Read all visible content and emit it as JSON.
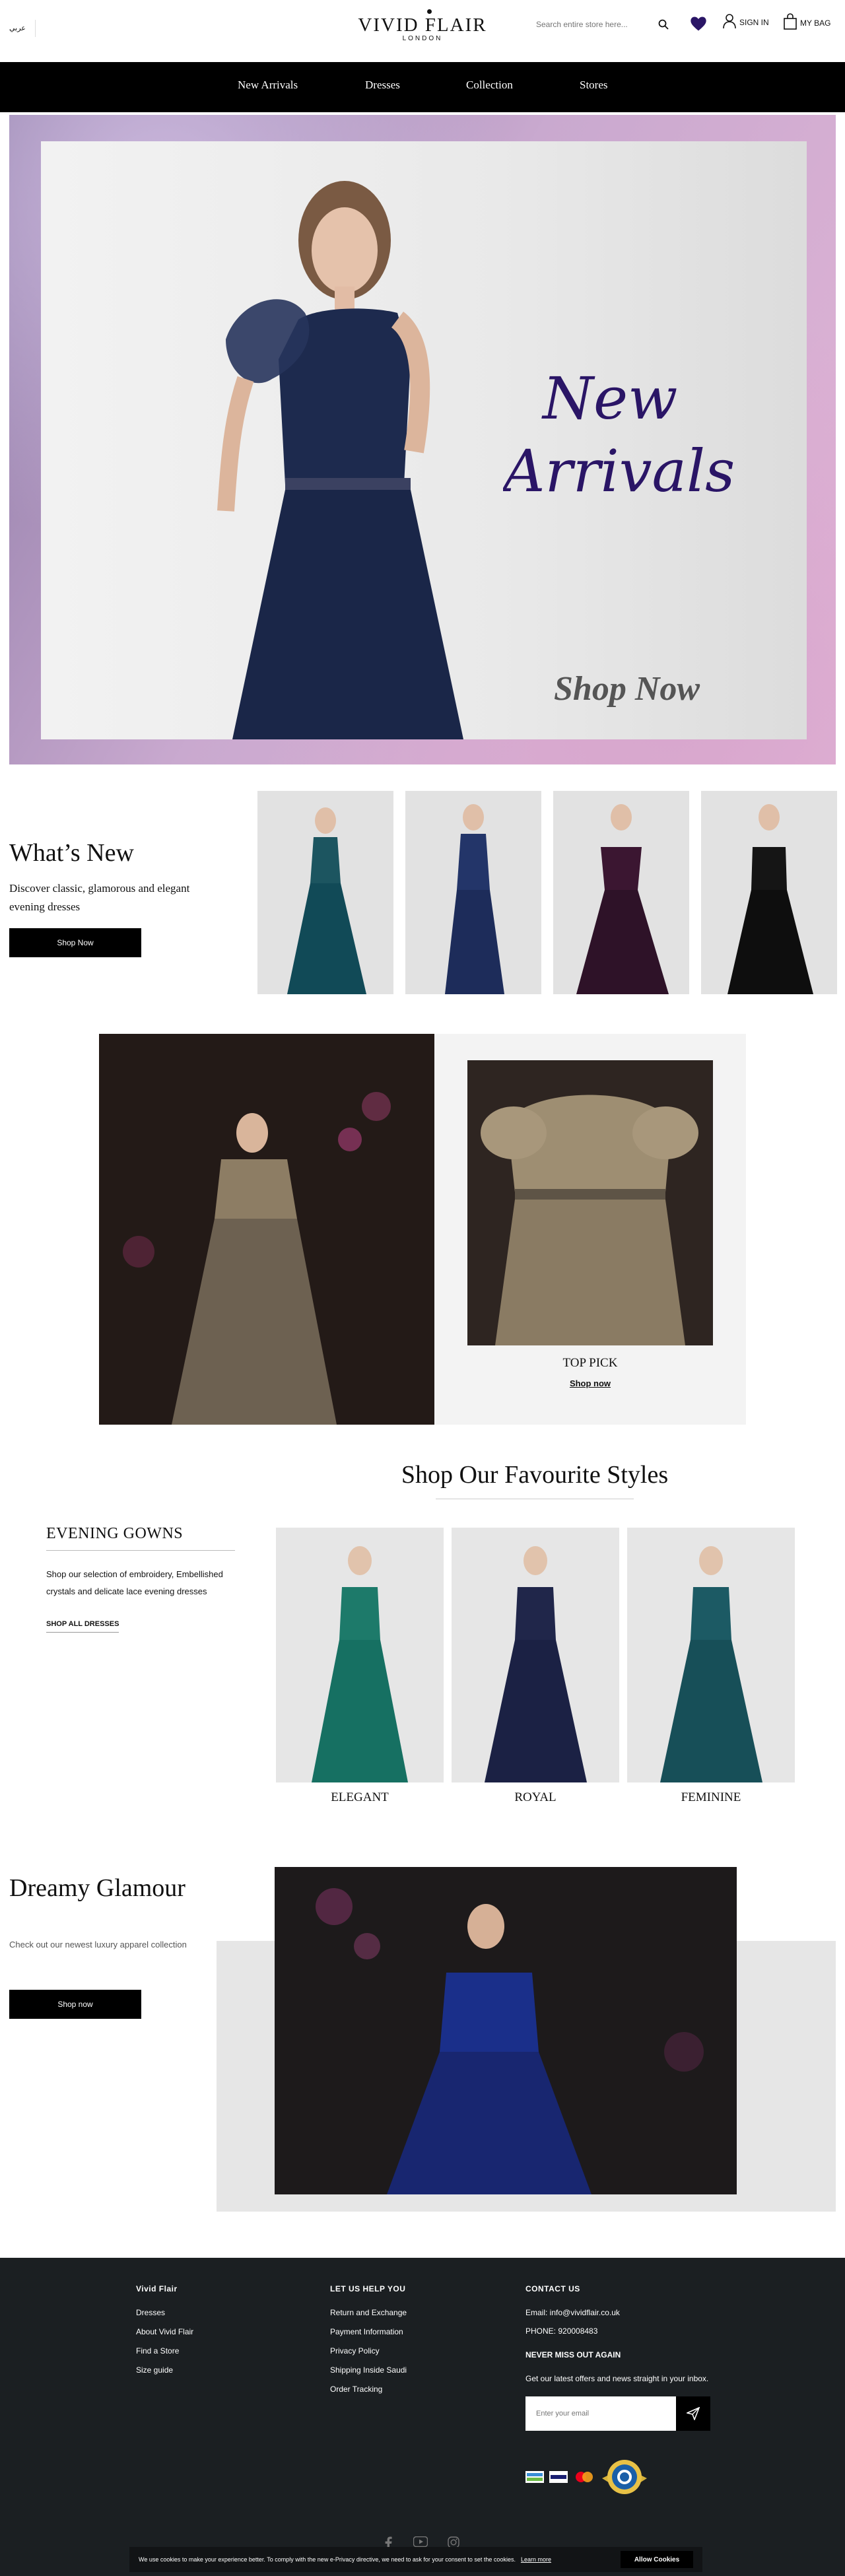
{
  "header": {
    "lang_label": "عربي",
    "logo_name": "VIVID FLAIR",
    "logo_sub": "LONDON",
    "search_placeholder": "Search entire store here...",
    "sign_in": "SIGN IN",
    "my_bag": "MY BAG"
  },
  "nav": [
    "New Arrivals",
    "Dresses",
    "Collection",
    "Stores"
  ],
  "hero": {
    "title_line1": "New",
    "title_line2": "Arrivals",
    "cta": "Shop Now"
  },
  "whats_new": {
    "title": "What’s New",
    "description": "Discover classic, glamorous and elegant evening dresses",
    "button": "Shop Now"
  },
  "top_pick": {
    "label": "TOP PICK",
    "link": "Shop now"
  },
  "favourites": {
    "title": "Shop Our Favourite Styles",
    "section_title": "EVENING GOWNS",
    "section_desc": "Shop our selection of embroidery, Embellished crystals and delicate lace evening dresses",
    "section_link": "SHOP ALL DRESSES",
    "styles": [
      "ELEGANT",
      "ROYAL",
      "FEMININE"
    ]
  },
  "dreamy": {
    "title": "Dreamy Glamour",
    "description": "Check out our newest luxury apparel collection",
    "button": "Shop now"
  },
  "footer": {
    "col1_head": "Vivid Flair",
    "col1_links": [
      "Dresses",
      "About Vivid Flair",
      "Find a Store",
      "Size guide"
    ],
    "col2_head": "LET US HELP YOU",
    "col2_links": [
      "Return and Exchange",
      "Payment Information",
      "Privacy Policy",
      "Shipping Inside Saudi",
      "Order Tracking"
    ],
    "col3_head": "CONTACT US",
    "email": "Email: info@vividflair.co.uk",
    "phone": "PHONE: 920008483",
    "newsletter_head": "NEVER MISS OUT AGAIN",
    "newsletter_desc": "Get our latest offers and news straight in your inbox.",
    "email_placeholder": "Enter your email"
  },
  "cookie": {
    "text": "We use cookies to make your experience better. To comply with the new e-Privacy directive, we need to ask for your consent to set the cookies.",
    "learn_more": "Learn more",
    "allow": "Allow Cookies"
  },
  "colors": {
    "accent": "#2a1566",
    "black": "#000000",
    "footer_bg": "#1b1f22"
  }
}
